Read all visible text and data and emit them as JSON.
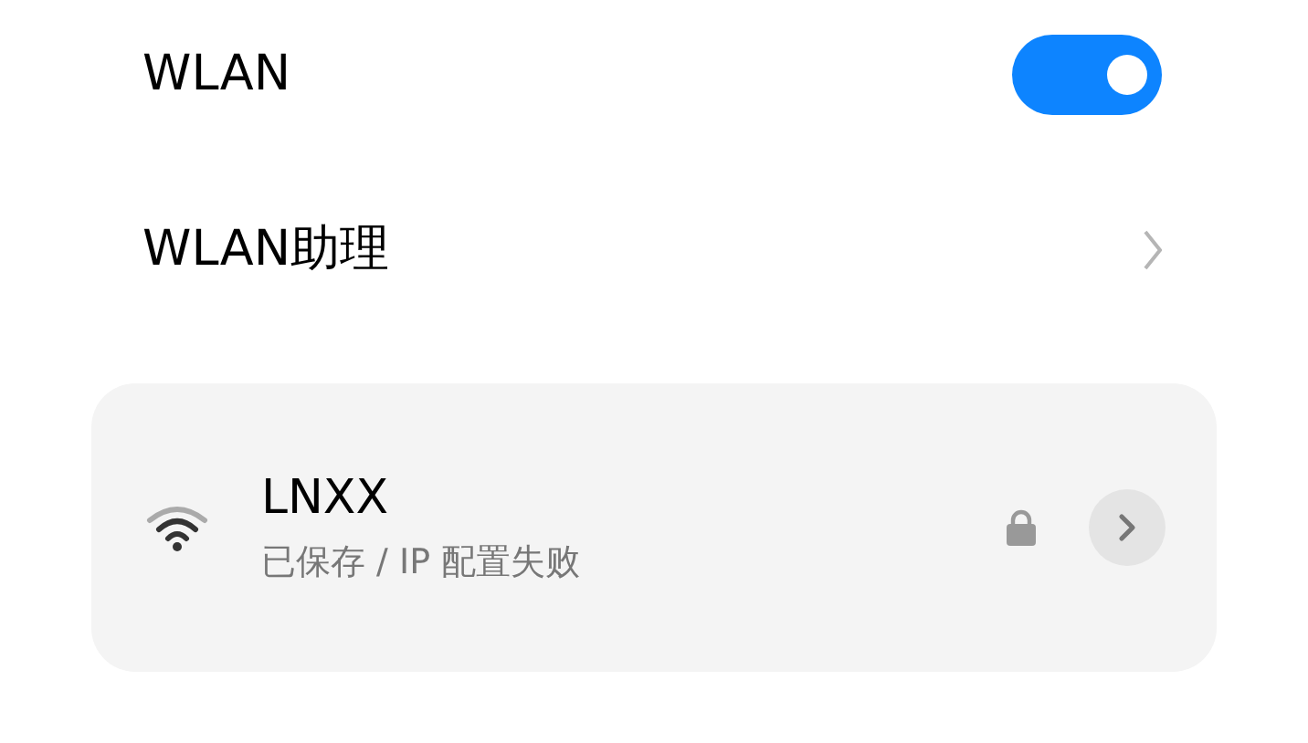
{
  "wlan": {
    "label": "WLAN",
    "on": true
  },
  "assistant": {
    "label": "WLAN助理"
  },
  "networks": [
    {
      "name": "LNXX",
      "status": "已保存 / IP 配置失败",
      "secured": true
    }
  ]
}
